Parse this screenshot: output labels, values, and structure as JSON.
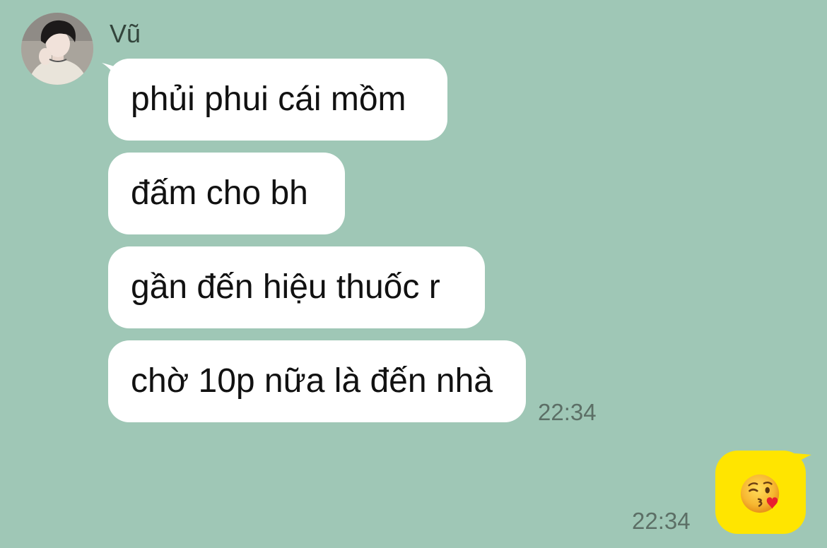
{
  "contact": {
    "name": "Vũ",
    "avatar": "profile-photo"
  },
  "incoming_messages": [
    {
      "text": "phủi phui cái mồm"
    },
    {
      "text": "đấm cho bh"
    },
    {
      "text": "gần đến hiệu thuốc r"
    },
    {
      "text": "chờ 10p nữa là đến nhà",
      "time": "22:34"
    }
  ],
  "outgoing_message": {
    "emoji": "face-blowing-a-kiss",
    "time": "22:34"
  },
  "colors": {
    "background": "#9fc7b6",
    "incoming_bubble": "#ffffff",
    "outgoing_bubble": "#ffe500"
  }
}
